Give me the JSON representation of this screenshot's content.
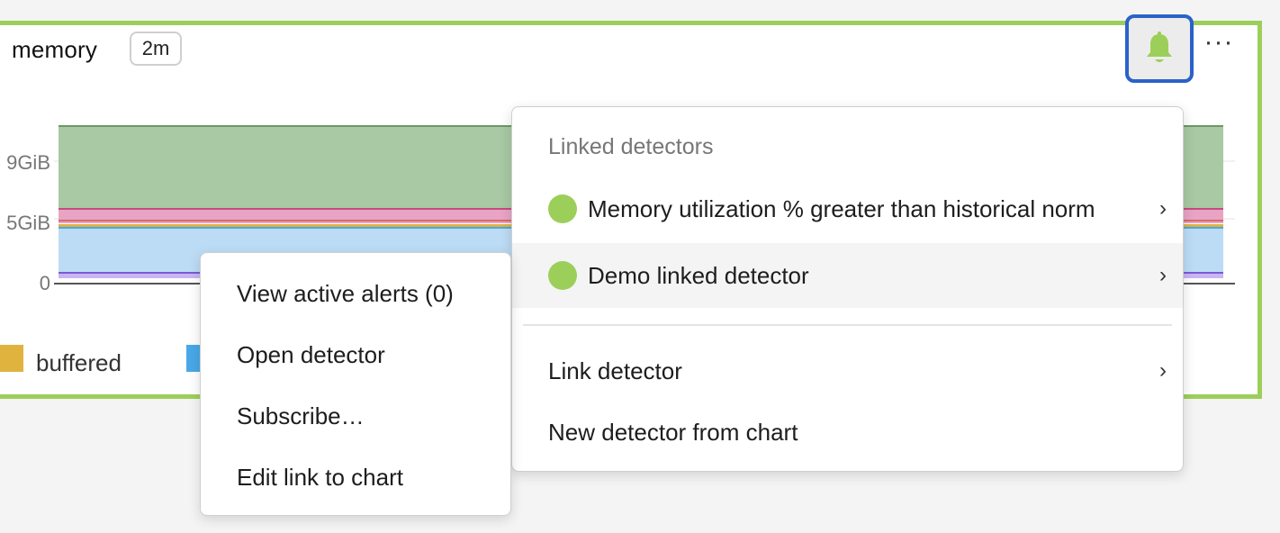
{
  "chart": {
    "title": "memory",
    "time_badge": "2m",
    "y_ticks": [
      "9GiB",
      "5GiB",
      "0"
    ],
    "legend": [
      {
        "label": "buffered",
        "color": "#e0b23e"
      },
      {
        "label": "",
        "color": "#4aa8e8"
      }
    ]
  },
  "header": {
    "alert_icon": "bell-icon",
    "alert_color": "#9ccf5a",
    "more_label": "···"
  },
  "linked_menu": {
    "header": "Linked detectors",
    "detectors": [
      {
        "label": "Memory utilization % greater than historical norm",
        "status_color": "#9ccf5a"
      },
      {
        "label": "Demo linked detector",
        "status_color": "#9ccf5a"
      }
    ],
    "link_detector": "Link detector",
    "new_detector": "New detector from chart",
    "chevron": "›"
  },
  "detector_submenu": {
    "items": [
      "View active alerts (0)",
      "Open detector",
      "Subscribe…",
      "Edit link to chart"
    ]
  }
}
